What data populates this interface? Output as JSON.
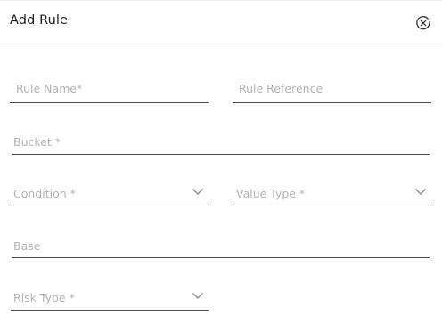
{
  "dialog": {
    "title": "Add Rule",
    "close_icon": "close-circle-icon"
  },
  "form": {
    "rule_name": {
      "placeholder": "Rule Name*",
      "value": ""
    },
    "rule_reference": {
      "placeholder": "Rule Reference",
      "value": ""
    },
    "bucket": {
      "placeholder": "Bucket *",
      "value": ""
    },
    "condition": {
      "placeholder": "Condition *",
      "value": "",
      "icon": "chevron-down-icon"
    },
    "value_type": {
      "placeholder": "Value Type *",
      "value": "",
      "icon": "chevron-down-icon"
    },
    "base": {
      "placeholder": "Base",
      "value": ""
    },
    "risk_type": {
      "placeholder": "Risk Type *",
      "value": "",
      "icon": "chevron-down-icon"
    }
  },
  "colors": {
    "underline": "#4a4a4a",
    "placeholder": "#b3b3b3",
    "title": "#202020",
    "divider": "#e4e4e4"
  }
}
